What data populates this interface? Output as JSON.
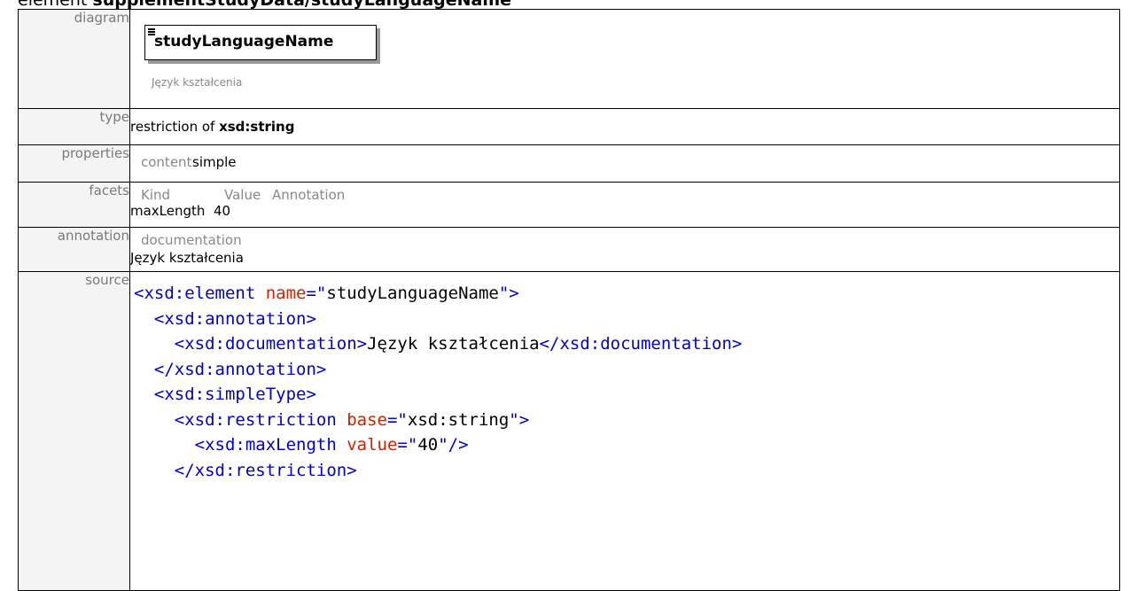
{
  "page": {
    "heading_prefix": "element ",
    "heading_path": "supplementStudyData/studyLanguageName"
  },
  "labels": {
    "diagram": "diagram",
    "type": "type",
    "properties": "properties",
    "facets": "facets",
    "annotation": "annotation",
    "source": "source"
  },
  "diagram": {
    "element_name": "studyLanguageName",
    "documentation": "Język kształcenia"
  },
  "type": {
    "prefix": "restriction of ",
    "base": "xsd:string"
  },
  "properties": {
    "key": "content",
    "value": "simple"
  },
  "facets": {
    "headers": [
      "Kind",
      "Value",
      "Annotation"
    ],
    "rows": [
      {
        "kind": "maxLength",
        "value": "40",
        "annotation": ""
      }
    ]
  },
  "annotation": {
    "header": "documentation",
    "text": "Język kształcenia"
  },
  "source": {
    "lines": [
      [
        [
          "tag",
          "<xsd:element "
        ],
        [
          "attr",
          "name"
        ],
        [
          "tag",
          "=\""
        ],
        [
          "str",
          "studyLanguageName"
        ],
        [
          "tag",
          "\">"
        ]
      ],
      [
        [
          "tag",
          "  <xsd:annotation>"
        ]
      ],
      [
        [
          "tag",
          "    <xsd:documentation>"
        ],
        [
          "str",
          "Język kształcenia"
        ],
        [
          "tag",
          "</xsd:documentation>"
        ]
      ],
      [
        [
          "tag",
          "  </xsd:annotation>"
        ]
      ],
      [
        [
          "tag",
          "  <xsd:simpleType>"
        ]
      ],
      [
        [
          "tag",
          "    <xsd:restriction "
        ],
        [
          "attr",
          "base"
        ],
        [
          "tag",
          "=\""
        ],
        [
          "str",
          "xsd:string"
        ],
        [
          "tag",
          "\">"
        ]
      ],
      [
        [
          "tag",
          "      <xsd:maxLength "
        ],
        [
          "attr",
          "value"
        ],
        [
          "tag",
          "=\""
        ],
        [
          "str",
          "40"
        ],
        [
          "tag",
          "\"/>"
        ]
      ],
      [
        [
          "tag",
          "    </xsd:restriction>"
        ]
      ]
    ]
  }
}
